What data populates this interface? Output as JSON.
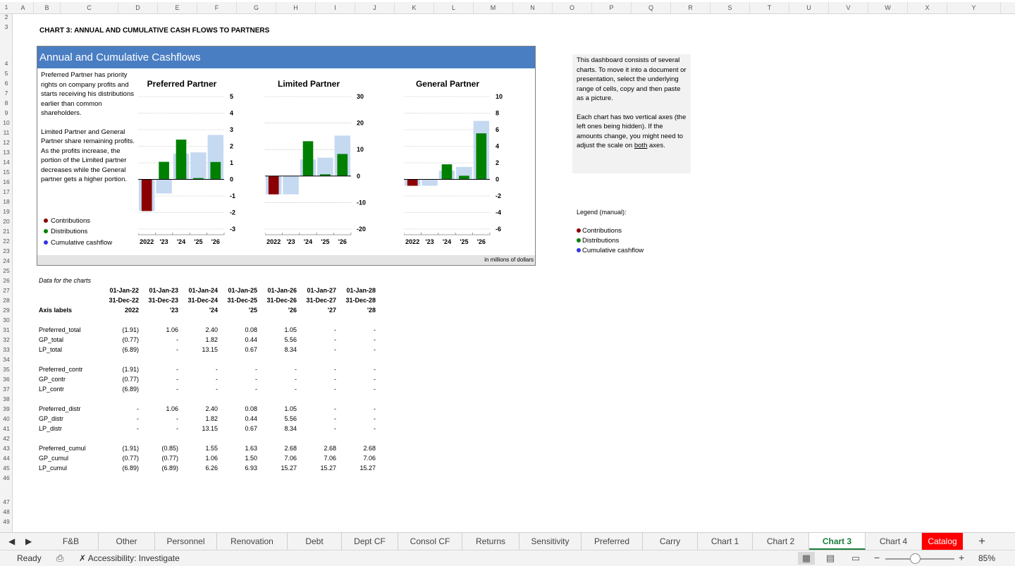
{
  "columns": [
    "A",
    "B",
    "C",
    "D",
    "E",
    "F",
    "G",
    "H",
    "I",
    "J",
    "K",
    "L",
    "M",
    "N",
    "O",
    "P",
    "Q",
    "R",
    "S",
    "T",
    "U",
    "V",
    "W",
    "X",
    "Y"
  ],
  "rows": [
    "1",
    "2",
    "3",
    "4",
    "5",
    "6",
    "7",
    "8",
    "9",
    "10",
    "11",
    "12",
    "13",
    "14",
    "15",
    "16",
    "17",
    "18",
    "19",
    "20",
    "21",
    "22",
    "23",
    "24",
    "25",
    "26",
    "27",
    "28",
    "29",
    "30",
    "31",
    "32",
    "33",
    "34",
    "35",
    "36",
    "37",
    "38",
    "39",
    "40",
    "41",
    "42",
    "43",
    "44",
    "45",
    "46",
    "47",
    "48",
    "49"
  ],
  "sheet_title": "CHART 3: ANNUAL AND CUMULATIVE CASH FLOWS TO PARTNERS",
  "dashboard": {
    "title": "Annual and Cumulative Cashflows",
    "desc_1": "Preferred Partner has priority rights on company profits and starts receiving his distributions earlier than common shareholders.",
    "desc_2": "Limited Partner and General Partner share remaining profits. As the profits increase, the portion of the Limited partner decreases while the General partner gets a higher portion.",
    "legend": [
      "Contributions",
      "Distributions",
      "Cumulative cashflow"
    ],
    "unit": "in millions of dollars"
  },
  "colors": {
    "contributions": "#8b0000",
    "distributions": "#008000",
    "cumulative": "#c5d9f1",
    "dot_contributions": "#8b0000",
    "dot_distributions": "#008000",
    "dot_cumulative": "#3333dd",
    "header": "#4a7ec3",
    "active_tab": "#1a7f3c"
  },
  "chart_data": [
    {
      "type": "bar",
      "title": "Preferred Partner",
      "categories": [
        "2022",
        "'23",
        "'24",
        "'25",
        "'26"
      ],
      "ylim": [
        -3,
        5
      ],
      "yticks": [
        "5",
        "4",
        "3",
        "2",
        "1",
        "0",
        "-1",
        "-2",
        "-3"
      ],
      "series": [
        {
          "name": "Contributions",
          "values": [
            -1.91,
            0,
            0,
            0,
            0
          ]
        },
        {
          "name": "Distributions",
          "values": [
            0,
            1.06,
            2.4,
            0.08,
            1.05
          ]
        },
        {
          "name": "Cumulative cashflow",
          "values": [
            -1.91,
            -0.85,
            1.55,
            1.63,
            2.68
          ]
        }
      ]
    },
    {
      "type": "bar",
      "title": "Limited Partner",
      "categories": [
        "2022",
        "'23",
        "'24",
        "'25",
        "'26"
      ],
      "ylim": [
        -20,
        30
      ],
      "yticks": [
        "30",
        "20",
        "10",
        "0",
        "-10",
        "-20"
      ],
      "series": [
        {
          "name": "Contributions",
          "values": [
            -6.89,
            0,
            0,
            0,
            0
          ]
        },
        {
          "name": "Distributions",
          "values": [
            0,
            0,
            13.15,
            0.67,
            8.34
          ]
        },
        {
          "name": "Cumulative cashflow",
          "values": [
            -6.89,
            -6.89,
            6.26,
            6.93,
            15.27
          ]
        }
      ]
    },
    {
      "type": "bar",
      "title": "General Partner",
      "categories": [
        "2022",
        "'23",
        "'24",
        "'25",
        "'26"
      ],
      "ylim": [
        -6,
        10
      ],
      "yticks": [
        "10",
        "8",
        "6",
        "4",
        "2",
        "0",
        "-2",
        "-4",
        "-6"
      ],
      "series": [
        {
          "name": "Contributions",
          "values": [
            -0.77,
            0,
            0,
            0,
            0
          ]
        },
        {
          "name": "Distributions",
          "values": [
            0,
            0,
            1.82,
            0.44,
            5.56
          ]
        },
        {
          "name": "Cumulative cashflow",
          "values": [
            -0.77,
            -0.77,
            1.06,
            1.5,
            7.06
          ]
        }
      ]
    }
  ],
  "notes": {
    "p1": "This dashboard consists of several charts. To move it into a document or presentation, select the underlying range of cells, copy and then paste as a picture.",
    "p2_a": "Each chart has two vertical axes (the left ones being hidden). If the amounts change, you might need to adjust the scale on ",
    "p2_u": "both",
    "p2_b": " axes."
  },
  "legend_manual": {
    "title": "Legend (manual):",
    "items": [
      "Contributions",
      "Distributions",
      "Cumulative cashflow"
    ]
  },
  "table": {
    "caption": "Data for the charts",
    "start_dates": [
      "01-Jan-22",
      "01-Jan-23",
      "01-Jan-24",
      "01-Jan-25",
      "01-Jan-26",
      "01-Jan-27",
      "01-Jan-28"
    ],
    "end_dates": [
      "31-Dec-22",
      "31-Dec-23",
      "31-Dec-24",
      "31-Dec-25",
      "31-Dec-26",
      "31-Dec-27",
      "31-Dec-28"
    ],
    "axis_label_title": "Axis labels",
    "axis_labels": [
      "2022",
      "'23",
      "'24",
      "'25",
      "'26",
      "'27",
      "'28"
    ],
    "groups": [
      [
        {
          "label": "Preferred_total",
          "values": [
            "(1.91)",
            "1.06",
            "2.40",
            "0.08",
            "1.05",
            "-",
            "-"
          ]
        },
        {
          "label": "GP_total",
          "values": [
            "(0.77)",
            "-",
            "1.82",
            "0.44",
            "5.56",
            "-",
            "-"
          ]
        },
        {
          "label": "LP_total",
          "values": [
            "(6.89)",
            "-",
            "13.15",
            "0.67",
            "8.34",
            "-",
            "-"
          ]
        }
      ],
      [
        {
          "label": "Preferred_contr",
          "values": [
            "(1.91)",
            "-",
            "-",
            "-",
            "-",
            "-",
            "-"
          ]
        },
        {
          "label": "GP_contr",
          "values": [
            "(0.77)",
            "-",
            "-",
            "-",
            "-",
            "-",
            "-"
          ]
        },
        {
          "label": "LP_contr",
          "values": [
            "(6.89)",
            "-",
            "-",
            "-",
            "-",
            "-",
            "-"
          ]
        }
      ],
      [
        {
          "label": "Preferred_distr",
          "values": [
            "-",
            "1.06",
            "2.40",
            "0.08",
            "1.05",
            "-",
            "-"
          ]
        },
        {
          "label": "GP_distr",
          "values": [
            "-",
            "-",
            "1.82",
            "0.44",
            "5.56",
            "-",
            "-"
          ]
        },
        {
          "label": "LP_distr",
          "values": [
            "-",
            "-",
            "13.15",
            "0.67",
            "8.34",
            "-",
            "-"
          ]
        }
      ],
      [
        {
          "label": "Preferred_cumul",
          "values": [
            "(1.91)",
            "(0.85)",
            "1.55",
            "1.63",
            "2.68",
            "2.68",
            "2.68"
          ]
        },
        {
          "label": "GP_cumul",
          "values": [
            "(0.77)",
            "(0.77)",
            "1.06",
            "1.50",
            "7.06",
            "7.06",
            "7.06"
          ]
        },
        {
          "label": "LP_cumul",
          "values": [
            "(6.89)",
            "(6.89)",
            "6.26",
            "6.93",
            "15.27",
            "15.27",
            "15.27"
          ]
        }
      ]
    ]
  },
  "tabs": [
    "F&B",
    "Other",
    "Personnel",
    "Renovation",
    "Debt",
    "Dept CF",
    "Consol CF",
    "Returns",
    "Sensitivity",
    "Preferred",
    "Carry",
    "Chart 1",
    "Chart 2",
    "Chart 3",
    "Chart 4",
    "Catalog"
  ],
  "active_tab": "Chart 3",
  "status": {
    "ready": "Ready",
    "accessibility": "Accessibility: Investigate",
    "zoom": "85%"
  }
}
